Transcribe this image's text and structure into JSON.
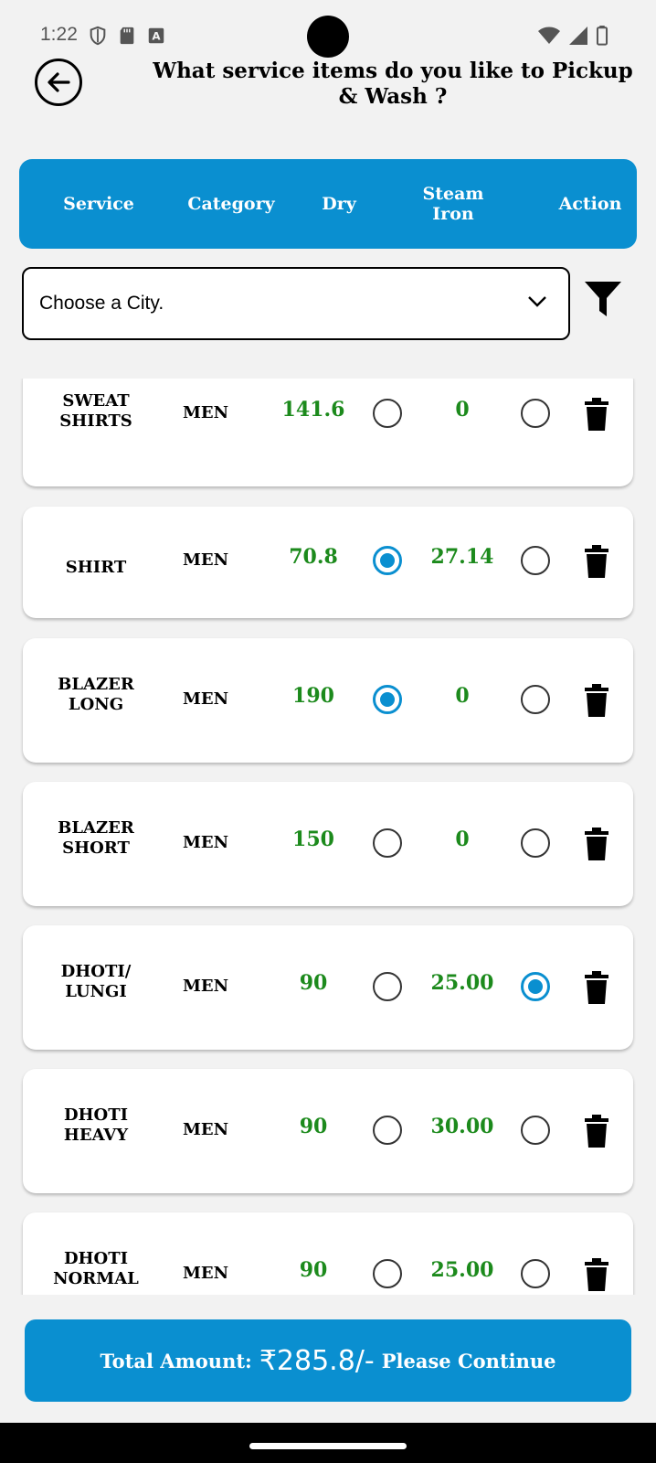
{
  "status_bar": {
    "time": "1:22"
  },
  "header": {
    "title": "What service items do you like to Pickup & Wash ?"
  },
  "columns": {
    "service": "Service",
    "category": "Category",
    "dry": "Dry",
    "steam_line1": "Steam",
    "steam_line2": "Iron",
    "action": "Action"
  },
  "city_select": {
    "placeholder": "Choose a City."
  },
  "items": [
    {
      "name1": "SWEAT",
      "name2": "SHIRTS",
      "category": "MEN",
      "dry_price": "141.6",
      "dry_selected": false,
      "steam_price": "0",
      "steam_selected": false
    },
    {
      "name1": "SHIRT",
      "name2": "",
      "category": "MEN",
      "dry_price": "70.8",
      "dry_selected": true,
      "steam_price": "27.14",
      "steam_selected": false
    },
    {
      "name1": "BLAZER",
      "name2": "LONG",
      "category": "MEN",
      "dry_price": "190",
      "dry_selected": true,
      "steam_price": "0",
      "steam_selected": false
    },
    {
      "name1": "BLAZER",
      "name2": "SHORT",
      "category": "MEN",
      "dry_price": "150",
      "dry_selected": false,
      "steam_price": "0",
      "steam_selected": false
    },
    {
      "name1": "DHOTI/",
      "name2": "LUNGI",
      "category": "MEN",
      "dry_price": "90",
      "dry_selected": false,
      "steam_price": "25.00",
      "steam_selected": true
    },
    {
      "name1": "DHOTI",
      "name2": "HEAVY",
      "category": "MEN",
      "dry_price": "90",
      "dry_selected": false,
      "steam_price": "30.00",
      "steam_selected": false
    },
    {
      "name1": "DHOTI",
      "name2": "NORMAL",
      "category": "MEN",
      "dry_price": "90",
      "dry_selected": false,
      "steam_price": "25.00",
      "steam_selected": false
    }
  ],
  "footer": {
    "total_label": "Total Amount:",
    "total_value": "₹285.8/-",
    "continue_label": "Please Continue"
  },
  "colors": {
    "accent": "#0a8fd0",
    "price_green": "#1c8a1c",
    "background": "#f2f2f2"
  }
}
